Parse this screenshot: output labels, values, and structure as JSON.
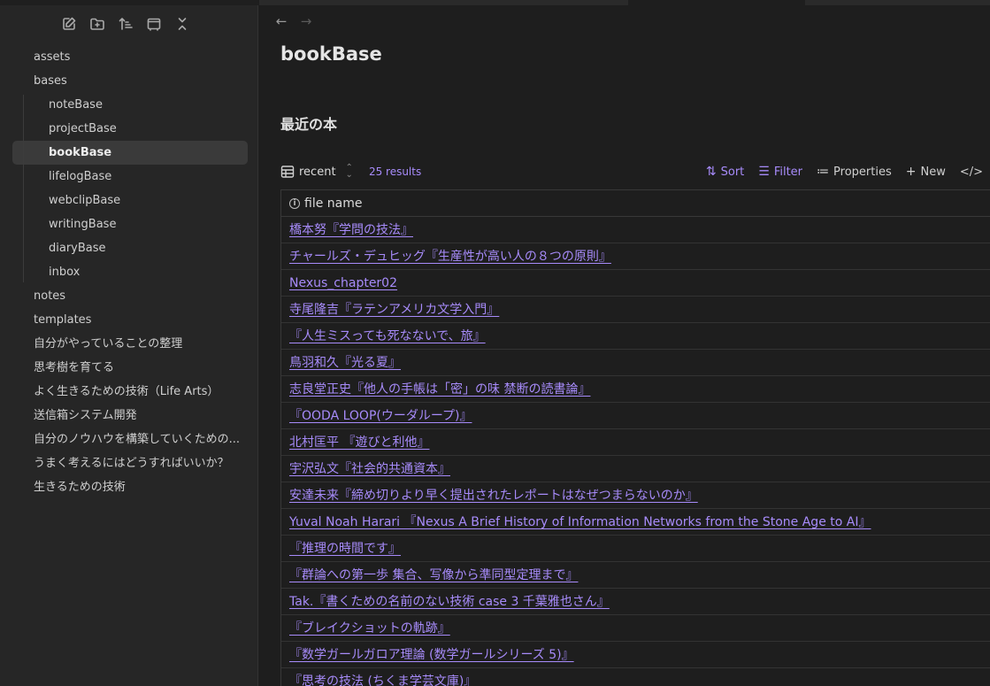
{
  "sidebar": {
    "toolbar": [
      {
        "icon": "new-note-icon"
      },
      {
        "icon": "new-folder-icon"
      },
      {
        "icon": "sort-icon"
      },
      {
        "icon": "collapse-view-icon"
      },
      {
        "icon": "collapse-all-icon"
      }
    ],
    "items": [
      {
        "label": "assets",
        "level": 0
      },
      {
        "label": "bases",
        "level": 0
      }
    ],
    "bases_children": [
      {
        "label": "noteBase"
      },
      {
        "label": "projectBase"
      },
      {
        "label": "bookBase",
        "active": true
      },
      {
        "label": "lifelogBase"
      },
      {
        "label": "webclipBase"
      },
      {
        "label": "writingBase"
      },
      {
        "label": "diaryBase"
      },
      {
        "label": "inbox"
      }
    ],
    "items_after": [
      {
        "label": "notes"
      },
      {
        "label": "templates"
      },
      {
        "label": "自分がやっていることの整理"
      },
      {
        "label": "思考樹を育てる"
      },
      {
        "label": "よく生きるための技術（Life Arts）"
      },
      {
        "label": "送信箱システム開発"
      },
      {
        "label": "自分のノウハウを構築していくための..."
      },
      {
        "label": "うまく考えるにはどうすればいいか？"
      },
      {
        "label": "生きるための技術"
      }
    ]
  },
  "main": {
    "nav": {
      "back": "←",
      "forward": "→"
    },
    "title": "bookBase",
    "section_title": "最近の本",
    "toolbar": {
      "view_name": "recent",
      "result_count": "25 results",
      "sort_label": "Sort",
      "filter_label": "Filter",
      "properties_label": "Properties",
      "new_label": "New",
      "code_label": "</>"
    },
    "table": {
      "column_header": "file name",
      "rows": [
        "橋本努『学問の技法』",
        "チャールズ・デュヒッグ『生産性が高い人の８つの原則』",
        "Nexus_chapter02",
        "寺尾隆吉『ラテンアメリカ文学入門』",
        "『人生ミスっても死なないで、旅』",
        "鳥羽和久『光る夏』",
        "志良堂正史『他人の手帳は「密」の味 禁断の読書論』",
        "『OODA LOOP(ウーダループ)』",
        "北村匡平 『遊びと利他』",
        "宇沢弘文『社会的共通資本』",
        "安達未来『締め切りより早く提出されたレポートはなぜつまらないのか』",
        "Yuval Noah Harari 『Nexus A Brief History of Information Networks from the Stone Age to AI』",
        "『推理の時間です』",
        "『群論への第一歩 集合、写像から準同型定理まで』",
        "Tak.『書くための名前のない技術 case 3 千葉雅也さん』",
        "『ブレイクショットの軌跡』",
        "『数学ガールガロア理論 (数学ガールシリーズ 5)』",
        "『思考の技法 (ちくま学芸文庫)』"
      ]
    }
  },
  "colors": {
    "accent": "#a78bfa",
    "sidebar_bg": "#262626",
    "main_bg": "#1e1e1e",
    "active_item_bg": "#3a3a3a"
  }
}
